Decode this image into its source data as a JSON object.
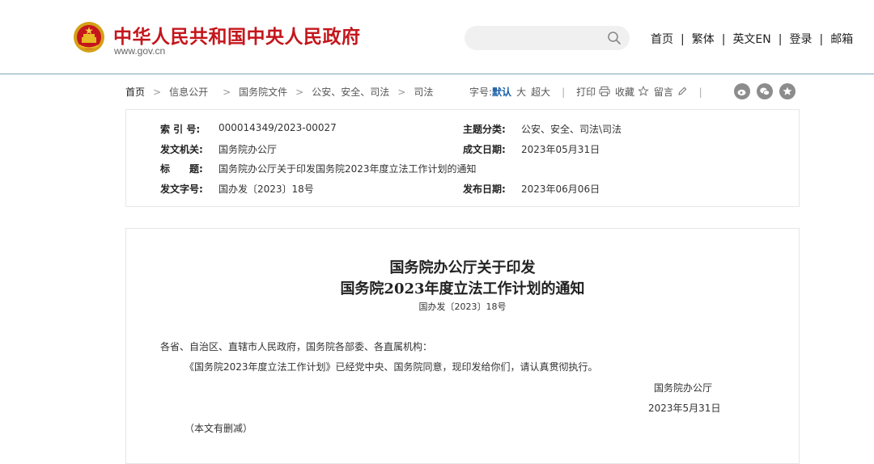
{
  "header": {
    "site_title": "中华人民共和国中央人民政府",
    "site_url": "www.gov.cn",
    "search_placeholder": "",
    "nav": [
      "首页",
      "繁体",
      "英文EN",
      "登录",
      "邮箱"
    ],
    "nav_separator": "|"
  },
  "breadcrumb": {
    "items": [
      "首页",
      "信息公开",
      "国务院文件",
      "公安、安全、司法",
      "司法"
    ]
  },
  "toolbar": {
    "font_label": "字号:",
    "font_default": "默认",
    "font_large": "大",
    "font_xlarge": "超大",
    "print": "打印",
    "favorite": "收藏",
    "comment": "留言",
    "separator": "|"
  },
  "meta": {
    "index_label": "索 引 号:",
    "index_value": "000014349/2023-00027",
    "category_label": "主题分类:",
    "category_value": "公安、安全、司法\\司法",
    "issuer_label": "发文机关:",
    "issuer_value": "国务院办公厅",
    "created_label": "成文日期:",
    "created_value": "2023年05月31日",
    "title_label": "标　　题:",
    "title_value": "国务院办公厅关于印发国务院2023年度立法工作计划的通知",
    "docno_label": "发文字号:",
    "docno_value": "国办发〔2023〕18号",
    "published_label": "发布日期:",
    "published_value": "2023年06月06日"
  },
  "article": {
    "title_line1": "国务院办公厅关于印发",
    "title_line2": "国务院2023年度立法工作计划的通知",
    "doc_number": "国办发〔2023〕18号",
    "salutation": "各省、自治区、直辖市人民政府，国务院各部委、各直属机构：",
    "body": "《国务院2023年度立法工作计划》已经党中央、国务院同意，现印发给你们，请认真贯彻执行。",
    "signature": "国务院办公厅",
    "date": "2023年5月31日",
    "note": "（本文有删减）"
  },
  "colors": {
    "brand_red": "#c4161c",
    "link_blue": "#1b5fa8",
    "header_rule": "#7fa6bb",
    "icon_gray": "#8c8c8c"
  },
  "icons": [
    "national-emblem-icon",
    "search-icon",
    "print-icon",
    "star-icon",
    "pencil-icon",
    "weibo-icon",
    "wechat-icon",
    "favorite-circle-icon"
  ]
}
